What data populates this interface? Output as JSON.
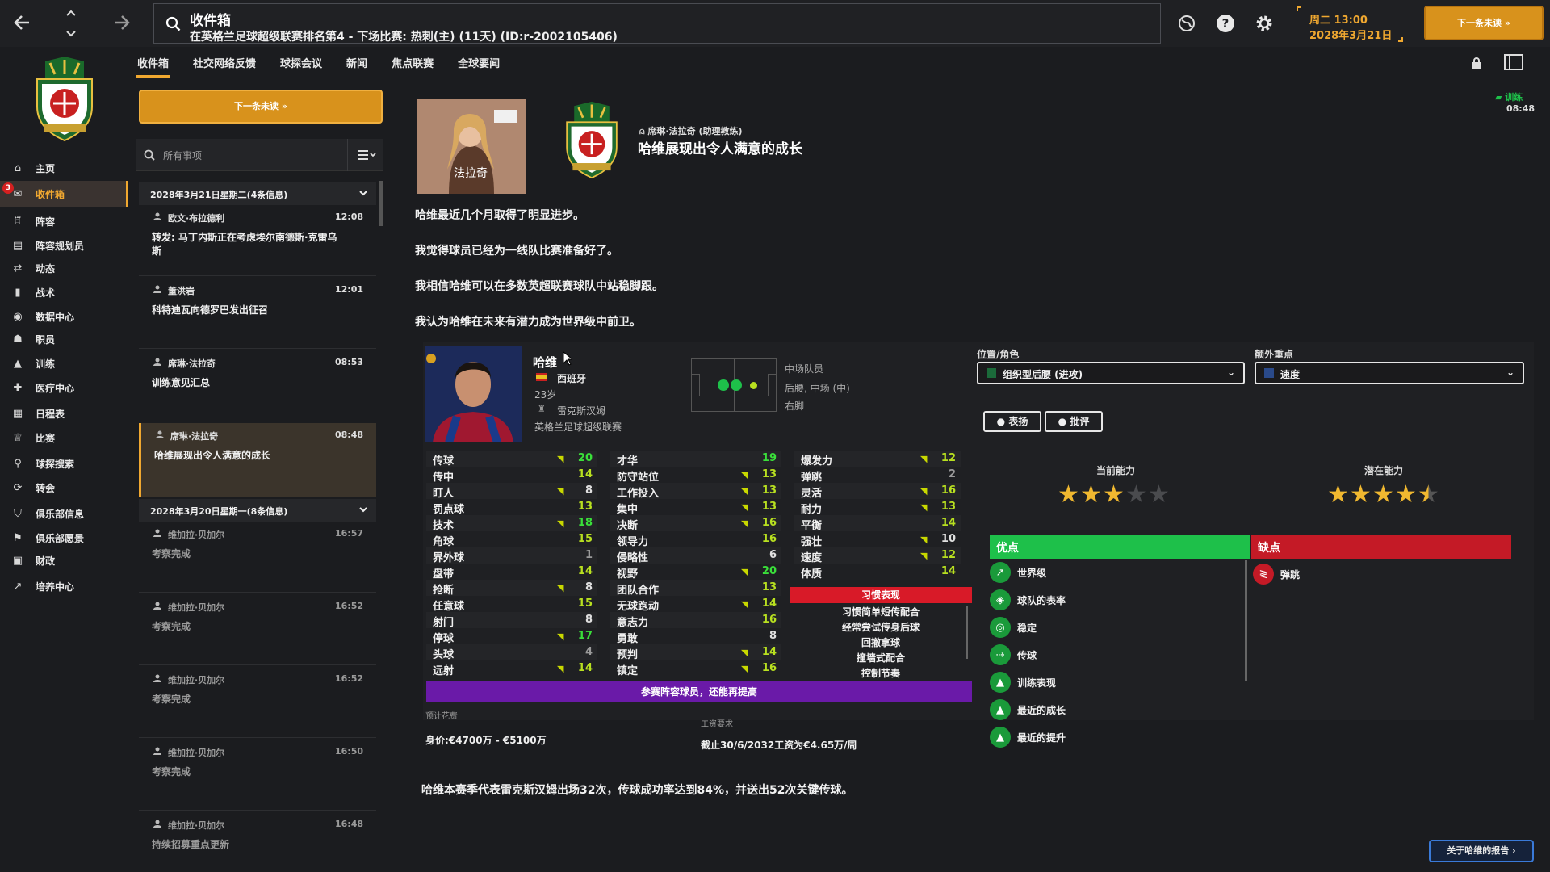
{
  "header": {
    "title": "收件箱",
    "subtitle": "在英格兰足球超级联赛排名第4 - 下场比赛: 热刺(主) (11天) (ID:r-2002105406)",
    "date_line1": "周二 13:00",
    "date_line2": "2028年3月21日",
    "continue_label": "下一条未读"
  },
  "sidebar": {
    "badge": "3",
    "items": [
      {
        "label": "主页",
        "icon": "home-icon"
      },
      {
        "label": "收件箱",
        "icon": "inbox-icon"
      },
      {
        "label": "阵容",
        "icon": "shirt-icon"
      },
      {
        "label": "阵容规划员",
        "icon": "clipboard-icon"
      },
      {
        "label": "动态",
        "icon": "dynamics-icon"
      },
      {
        "label": "战术",
        "icon": "tactics-icon"
      },
      {
        "label": "数据中心",
        "icon": "data-icon"
      },
      {
        "label": "职员",
        "icon": "staff-icon"
      },
      {
        "label": "训练",
        "icon": "training-icon"
      },
      {
        "label": "医疗中心",
        "icon": "medical-icon"
      },
      {
        "label": "日程表",
        "icon": "calendar-icon"
      },
      {
        "label": "比赛",
        "icon": "trophy-icon"
      },
      {
        "label": "球探搜索",
        "icon": "search-icon"
      },
      {
        "label": "转会",
        "icon": "transfer-icon"
      },
      {
        "label": "俱乐部信息",
        "icon": "shield-icon"
      },
      {
        "label": "俱乐部愿景",
        "icon": "vision-icon"
      },
      {
        "label": "财政",
        "icon": "finance-icon"
      },
      {
        "label": "培养中心",
        "icon": "development-icon"
      }
    ]
  },
  "subtabs": [
    "收件箱",
    "社交网络反馈",
    "球探会议",
    "新闻",
    "焦点联赛",
    "全球要闻"
  ],
  "inbox": {
    "next_label": "下一条未读",
    "filter_label": "所有事项",
    "groups": [
      {
        "title": "2028年3月21日星期二(4条信息)"
      },
      {
        "title": "2028年3月20日星期一(8条信息)"
      }
    ],
    "messages": [
      {
        "sender": "欧文·布拉德利",
        "time": "12:08",
        "subject": "转发: 马丁内斯正在考虑埃尔南德斯·克雷乌斯"
      },
      {
        "sender": "董洪岩",
        "time": "12:01",
        "subject": "科特迪瓦向德罗巴发出征召"
      },
      {
        "sender": "席琳·法拉奇",
        "time": "08:53",
        "subject": "训练意见汇总"
      },
      {
        "sender": "席琳·法拉奇",
        "time": "08:48",
        "subject": "哈维展现出令人满意的成长"
      },
      {
        "sender": "维加拉·贝加尔",
        "time": "16:57",
        "subject": "考察完成"
      },
      {
        "sender": "维加拉·贝加尔",
        "time": "16:52",
        "subject": "考察完成"
      },
      {
        "sender": "维加拉·贝加尔",
        "time": "16:52",
        "subject": "考察完成"
      },
      {
        "sender": "维加拉·贝加尔",
        "time": "16:50",
        "subject": "考察完成"
      },
      {
        "sender": "维加拉·贝加尔",
        "time": "16:48",
        "subject": "持续招募重点更新"
      }
    ]
  },
  "message": {
    "sender_caption": "法拉奇",
    "sender_line": "席琳·法拉奇 (助理教练)",
    "title": "哈维展现出令人满意的成长",
    "training_label": "训练",
    "training_time": "08:48",
    "paragraphs": [
      "哈维最近几个月取得了明显进步。",
      "我觉得球员已经为一线队比赛准备好了。",
      "我相信哈维可以在多数英超联赛球队中站稳脚跟。",
      "我认为哈维在未来有潜力成为世界级中前卫。"
    ],
    "footer_text": "哈维本赛季代表雷克斯汉姆出场32次，传球成功率达到84%，并送出52次关键传球。",
    "report_button": "关于哈维的报告"
  },
  "player": {
    "name": "哈维",
    "nation": "西班牙",
    "age": "23岁",
    "club": "雷克斯汉姆",
    "league": "英格兰足球超级联赛",
    "role_type": "中场队员",
    "positions": "后腰, 中场 (中)",
    "foot": "右脚",
    "position_label": "位置/角色",
    "position_value": "组织型后腰 (进攻)",
    "focus_label": "额外重点",
    "focus_value": "速度",
    "praise_label": "表扬",
    "criticize_label": "批评",
    "current_ability_label": "当前能力",
    "potential_ability_label": "潜在能力",
    "current_stars": 3,
    "potential_stars": 4.5,
    "strengths_label": "优点",
    "weaknesses_label": "缺点",
    "strengths": [
      "世界级",
      "球队的表率",
      "稳定",
      "传球",
      "训练表现",
      "最近的成长",
      "最近的提升"
    ],
    "weaknesses": [
      "弹跳"
    ],
    "habits_title": "习惯表现",
    "habits": [
      "习惯简单短传配合",
      "经常尝试传身后球",
      "回撤拿球",
      "撞墙式配合",
      "控制节奏"
    ],
    "banner": "参赛阵容球员，还能再提高",
    "value_label": "预计花费",
    "value": "身价:€4700万 - €5100万",
    "wage_label": "工资要求",
    "wage": "截止30/6/2032工资为€4.65万/周",
    "attr_col1": [
      {
        "n": "传球",
        "v": "20",
        "c": "#3adf3a",
        "up": true
      },
      {
        "n": "传中",
        "v": "14",
        "c": "#b8e020",
        "up": false
      },
      {
        "n": "盯人",
        "v": "8",
        "c": "#e0e0e0",
        "up": true
      },
      {
        "n": "罚点球",
        "v": "13",
        "c": "#b8e020",
        "up": false
      },
      {
        "n": "技术",
        "v": "18",
        "c": "#3adf3a",
        "up": true
      },
      {
        "n": "角球",
        "v": "15",
        "c": "#b8e020",
        "up": false
      },
      {
        "n": "界外球",
        "v": "1",
        "c": "#9a9a9a",
        "up": false
      },
      {
        "n": "盘带",
        "v": "14",
        "c": "#b8e020",
        "up": false
      },
      {
        "n": "抢断",
        "v": "8",
        "c": "#e0e0e0",
        "up": true
      },
      {
        "n": "任意球",
        "v": "15",
        "c": "#b8e020",
        "up": false
      },
      {
        "n": "射门",
        "v": "8",
        "c": "#e0e0e0",
        "up": false
      },
      {
        "n": "停球",
        "v": "17",
        "c": "#3adf3a",
        "up": true
      },
      {
        "n": "头球",
        "v": "4",
        "c": "#9a9a9a",
        "up": false
      },
      {
        "n": "远射",
        "v": "14",
        "c": "#b8e020",
        "up": true
      }
    ],
    "attr_col2": [
      {
        "n": "才华",
        "v": "19",
        "c": "#3adf3a",
        "up": false
      },
      {
        "n": "防守站位",
        "v": "13",
        "c": "#b8e020",
        "up": true
      },
      {
        "n": "工作投入",
        "v": "13",
        "c": "#b8e020",
        "up": true
      },
      {
        "n": "集中",
        "v": "13",
        "c": "#b8e020",
        "up": true
      },
      {
        "n": "决断",
        "v": "16",
        "c": "#b8e020",
        "up": true
      },
      {
        "n": "领导力",
        "v": "16",
        "c": "#b8e020",
        "up": false
      },
      {
        "n": "侵略性",
        "v": "6",
        "c": "#e0e0e0",
        "up": false
      },
      {
        "n": "视野",
        "v": "20",
        "c": "#3adf3a",
        "up": true
      },
      {
        "n": "团队合作",
        "v": "13",
        "c": "#b8e020",
        "up": false
      },
      {
        "n": "无球跑动",
        "v": "14",
        "c": "#b8e020",
        "up": true
      },
      {
        "n": "意志力",
        "v": "16",
        "c": "#b8e020",
        "up": false
      },
      {
        "n": "勇敢",
        "v": "8",
        "c": "#e0e0e0",
        "up": false
      },
      {
        "n": "预判",
        "v": "14",
        "c": "#b8e020",
        "up": true
      },
      {
        "n": "镇定",
        "v": "16",
        "c": "#b8e020",
        "up": true
      }
    ],
    "attr_col3": [
      {
        "n": "爆发力",
        "v": "12",
        "c": "#b8e020",
        "up": true
      },
      {
        "n": "弹跳",
        "v": "2",
        "c": "#9a9a9a",
        "up": false
      },
      {
        "n": "灵活",
        "v": "16",
        "c": "#b8e020",
        "up": true
      },
      {
        "n": "耐力",
        "v": "13",
        "c": "#b8e020",
        "up": true
      },
      {
        "n": "平衡",
        "v": "14",
        "c": "#b8e020",
        "up": false
      },
      {
        "n": "强壮",
        "v": "10",
        "c": "#e0e0e0",
        "up": true
      },
      {
        "n": "速度",
        "v": "12",
        "c": "#b8e020",
        "up": true
      },
      {
        "n": "体质",
        "v": "14",
        "c": "#b8e020",
        "up": false
      }
    ]
  },
  "colors": {
    "accent": "#f0a830",
    "strengths": "#1ec04a",
    "weaknesses": "#c41a26",
    "banner": "#6a1aa8",
    "habits": "#d81a28"
  }
}
